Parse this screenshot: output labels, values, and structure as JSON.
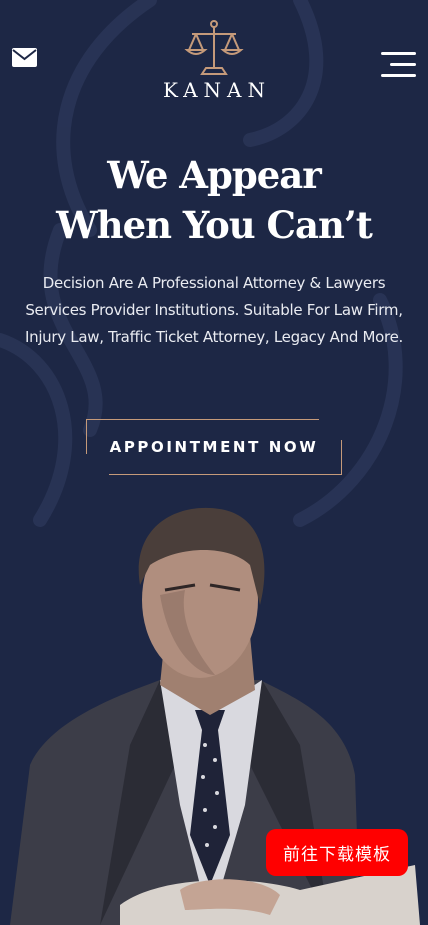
{
  "colors": {
    "background": "#1d2745",
    "accent": "#c59a7a",
    "download_button": "#ff0000",
    "text": "#ffffff"
  },
  "header": {
    "mail_icon": "mail-icon",
    "menu_icon": "hamburger-menu-icon",
    "logo_icon": "scales-of-justice-icon",
    "logo_text": "KANAN"
  },
  "hero": {
    "title_line1": "We Appear",
    "title_line2": "When You Can’t",
    "description": "Decision Are A Professional Attorney & Lawyers Services Provider Institutions. Suitable For Law Firm, Injury Law, Traffic Ticket Attorney, Legacy And More.",
    "cta_label": "APPOINTMENT NOW"
  },
  "floating": {
    "download_label": "前往下载模板"
  }
}
